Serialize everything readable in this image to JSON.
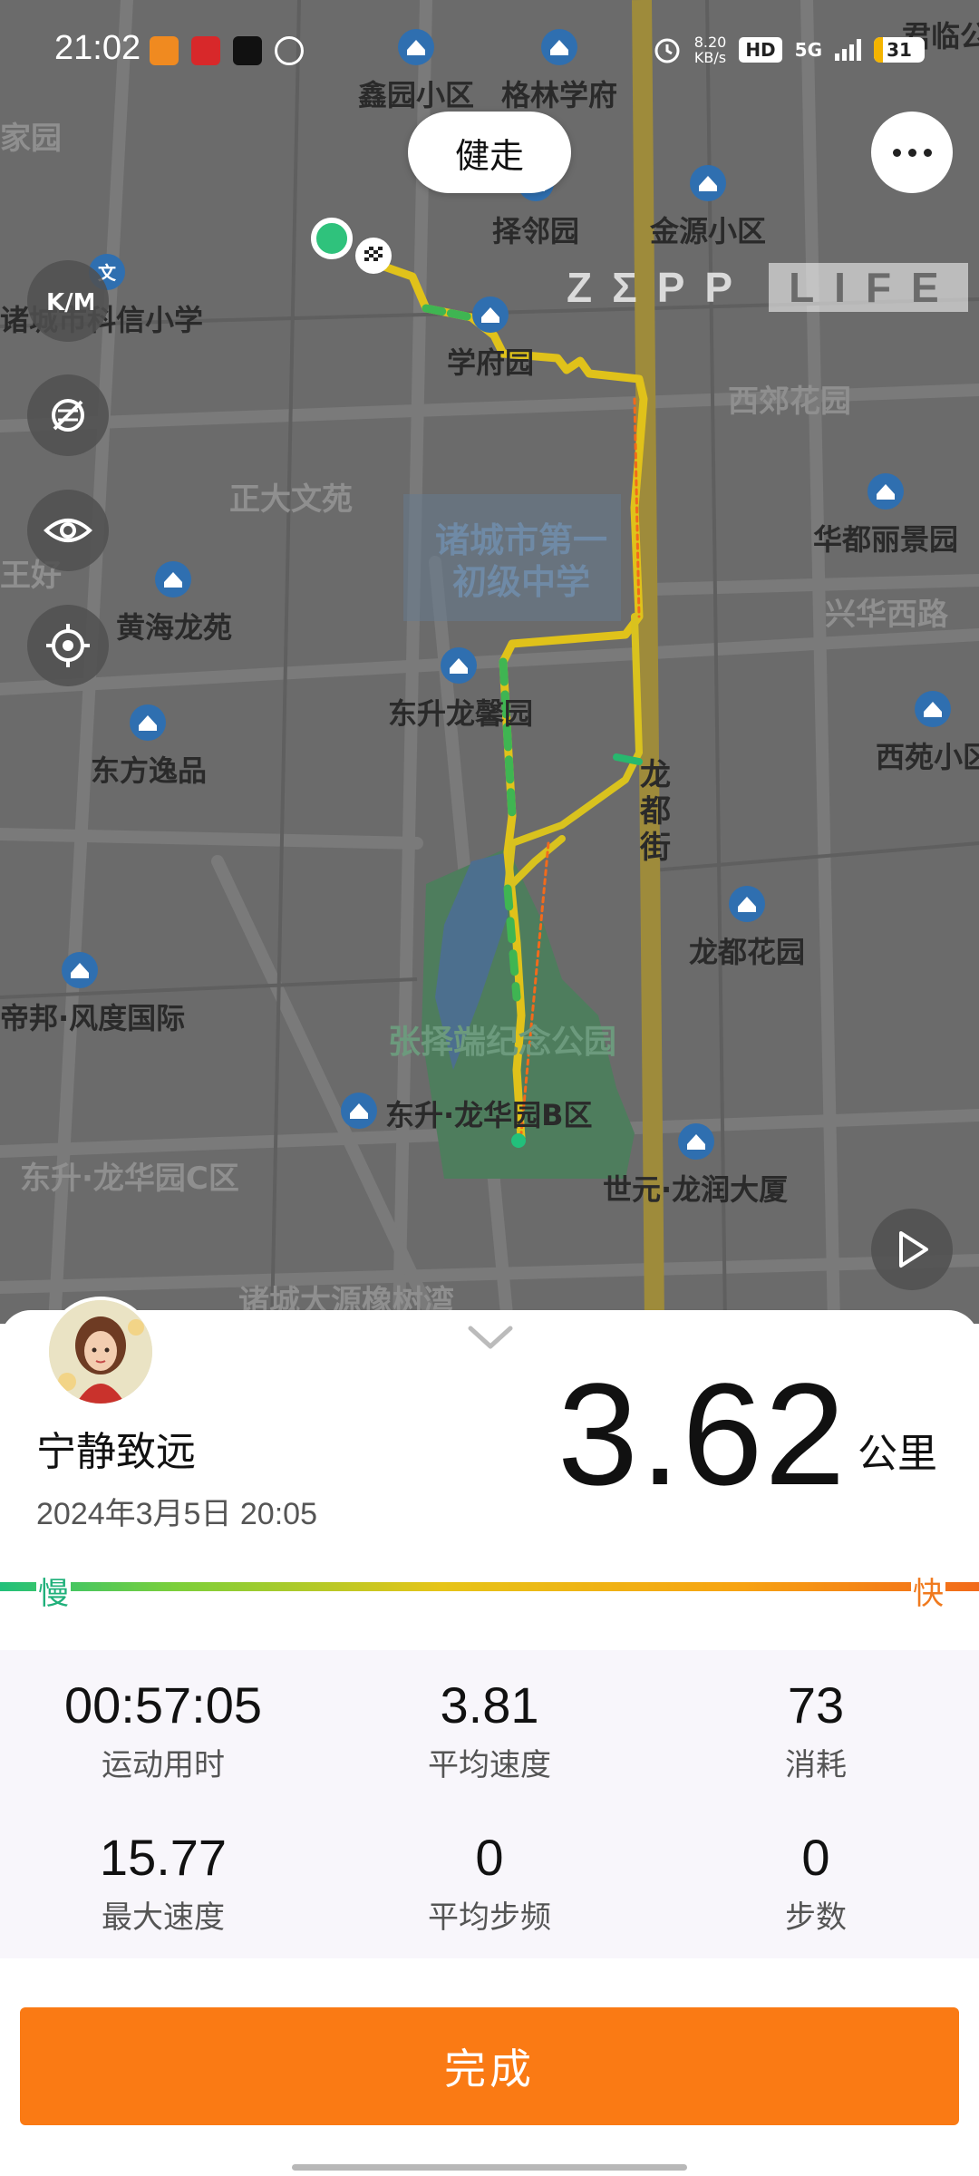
{
  "status_bar": {
    "time": "21:02",
    "network_speed": "8.20\nKB/s",
    "hd_badge": "HD",
    "network_type": "5G",
    "battery": "31",
    "icons": [
      "orange-app-icon",
      "red-app-icon",
      "tiktok-icon",
      "wechat-icon",
      "alarm-icon",
      "hd-icon",
      "signal-icon",
      "battery-icon"
    ]
  },
  "map": {
    "activity_type": "健走",
    "watermark": {
      "zepp": "ZΣPP",
      "life": "LIFE"
    },
    "pois": [
      "鑫园小区",
      "格林学府",
      "君临公",
      "择邻园",
      "金源小区",
      "诸城市科信小学",
      "学府园",
      "西郊花园",
      "华都丽景园",
      "黄海龙苑",
      "东升龙馨园",
      "西苑小区",
      "东方逸品",
      "龙都花园",
      "帝邦·风度国际",
      "东升·龙华园B区",
      "世元·龙润大厦"
    ],
    "area_labels": [
      "家园",
      "正大文苑",
      "王好",
      "兴华西路",
      "东升·龙华园C区",
      "诸城大源橡树湾"
    ],
    "school_label": "诸城市第一\n初级中学",
    "park_label": "张择端纪念公园",
    "street_vertical": [
      "龙",
      "都",
      "街"
    ],
    "side_buttons": [
      "km-toggle-icon",
      "map-layer-off-icon",
      "eye-icon",
      "locate-icon"
    ],
    "route_colors": {
      "slow": "#22c07b",
      "mid": "#e6c418",
      "fast": "#f26a1b",
      "track": "#d5b530"
    }
  },
  "summary": {
    "username": "宁静致远",
    "datetime": "2024年3月5日 20:05",
    "distance": "3.62",
    "unit": "公里",
    "pace_slow_label": "慢",
    "pace_fast_label": "快",
    "stats": [
      {
        "value": "00:57:05",
        "label": "运动用时"
      },
      {
        "value": "3.81",
        "label": "平均速度"
      },
      {
        "value": "73",
        "label": "消耗"
      },
      {
        "value": "15.77",
        "label": "最大速度"
      },
      {
        "value": "0",
        "label": "平均步频"
      },
      {
        "value": "0",
        "label": "步数"
      }
    ],
    "done_label": "完成"
  },
  "colors": {
    "accent": "#fa7a14",
    "map_bg": "#6b6b6b"
  }
}
